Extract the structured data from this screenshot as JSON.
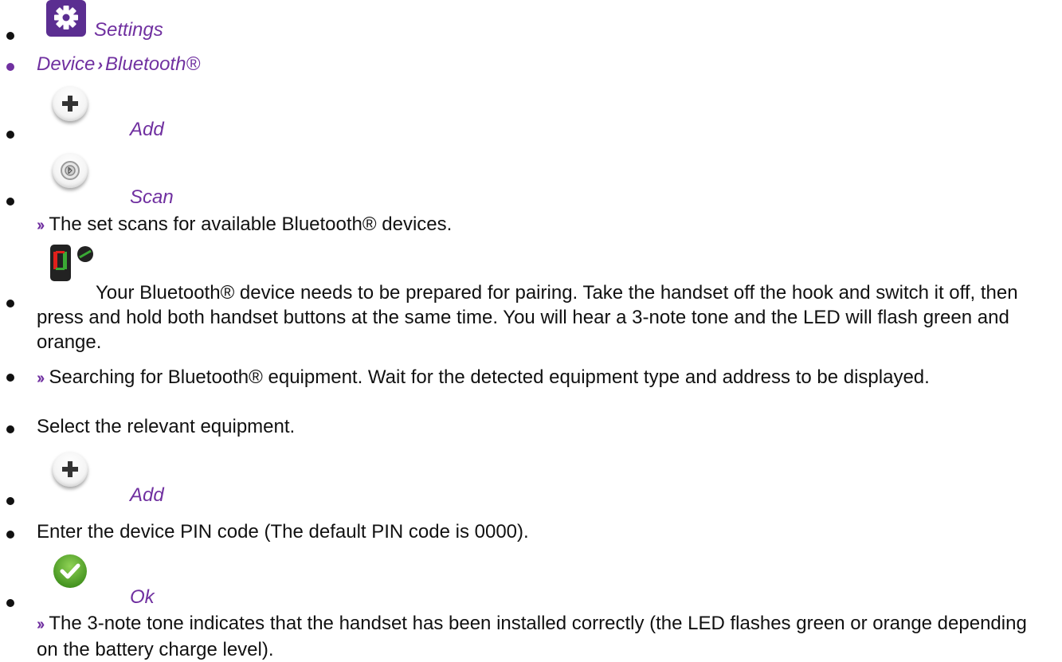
{
  "steps": {
    "settings_label": "Settings",
    "device": "Device",
    "bluetooth": "Bluetooth®",
    "add_label_1": "Add",
    "scan_label": "Scan",
    "scan_result": "The set scans for available Bluetooth® devices.",
    "prepare_text": "Your Bluetooth® device needs to be prepared for pairing. Take the handset off the hook and switch it off, then press and hold both handset buttons at the same time. You will hear a 3-note tone and the LED will flash green and orange.",
    "searching_text": "Searching for Bluetooth® equipment. Wait for the detected equipment type and address to be displayed.",
    "select_text": "Select the relevant equipment.",
    "add_label_2": "Add",
    "pin_text": "Enter the device PIN code (The default PIN code is 0000).",
    "ok_label": "Ok",
    "ok_result": "The 3-note tone indicates that the handset has been installed correctly (the LED flashes green or orange depending on the battery charge level)."
  },
  "icons": {
    "settings": "gear-icon",
    "add": "plus-icon",
    "scan": "scan-icon",
    "handset": "bluetooth-handset-icon",
    "ok": "checkmark-icon"
  },
  "colors": {
    "accent": "#7030a0",
    "settings_bg": "#5b2e91",
    "ok_green": "#5aa82a"
  }
}
